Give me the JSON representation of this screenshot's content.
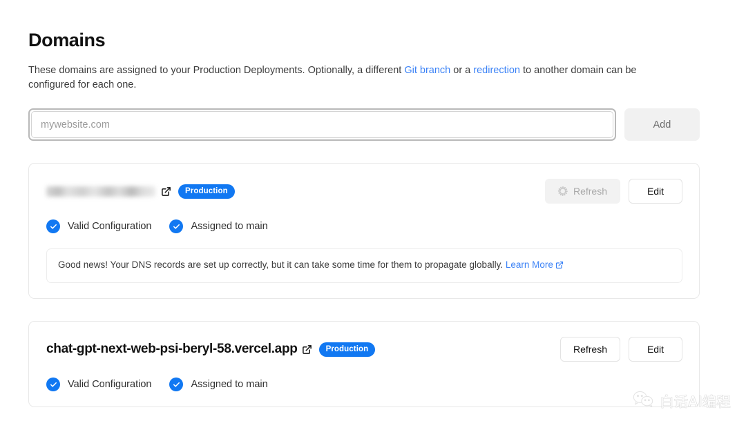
{
  "header": {
    "title": "Domains",
    "description_parts": {
      "part1": "These domains are assigned to your Production Deployments. Optionally, a different ",
      "link1": "Git branch",
      "part2": " or a ",
      "link2": "redirection",
      "part3": " to another domain can be configured for each one."
    }
  },
  "add_form": {
    "input_placeholder": "mywebsite.com",
    "input_value": "",
    "add_label": "Add"
  },
  "domains": [
    {
      "name": "",
      "name_redacted": true,
      "external_link_icon": "external-link-icon",
      "badge": "Production",
      "refresh_label": "Refresh",
      "refresh_disabled": true,
      "refresh_icon": "spinner-icon",
      "edit_label": "Edit",
      "statuses": [
        {
          "icon": "check-circle-icon",
          "label": "Valid Configuration"
        },
        {
          "icon": "check-circle-icon",
          "label": "Assigned to main"
        }
      ],
      "notice": {
        "text": "Good news! Your DNS records are set up correctly, but it can take some time for them to propagate globally. ",
        "link": "Learn More",
        "link_icon": "external-link-icon"
      }
    },
    {
      "name": "chat-gpt-next-web-psi-beryl-58.vercel.app",
      "name_redacted": false,
      "external_link_icon": "external-link-icon",
      "badge": "Production",
      "refresh_label": "Refresh",
      "refresh_disabled": false,
      "refresh_icon": "",
      "edit_label": "Edit",
      "statuses": [
        {
          "icon": "check-circle-icon",
          "label": "Valid Configuration"
        },
        {
          "icon": "check-circle-icon",
          "label": "Assigned to main"
        }
      ],
      "notice": null
    }
  ],
  "watermark": {
    "icon": "wechat-icon",
    "text": "白话AI编程"
  },
  "colors": {
    "accent_blue": "#1178f2",
    "link_blue": "#3b82f6",
    "card_border": "#e8e8e8",
    "disabled_bg": "#f2f2f2",
    "text_primary": "#111111"
  }
}
